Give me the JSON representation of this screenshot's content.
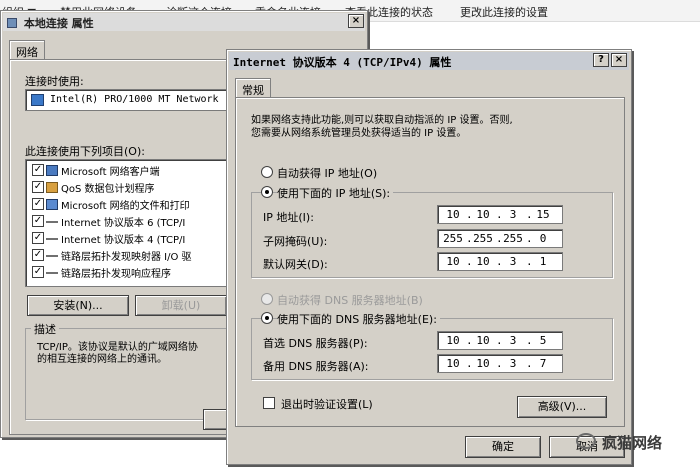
{
  "command_bar": {
    "items": [
      "组织 ▼",
      "禁用此网络设备",
      "诊断这个连接",
      "重命名此连接",
      "查看此连接的状态",
      "更改此连接的设置"
    ]
  },
  "local_conn": {
    "title": "本地连接 属性",
    "close": "×",
    "tab": "网络",
    "connect_using_label": "连接时使用:",
    "adapter": "Intel(R) PRO/1000 MT Network",
    "items_label": "此连接使用下列项目(O):",
    "items": [
      {
        "label": "Microsoft 网络客户端",
        "checked": true,
        "icon": "network-client-icon"
      },
      {
        "label": "QoS 数据包计划程序",
        "checked": true,
        "icon": "qos-icon"
      },
      {
        "label": "Microsoft 网络的文件和打印",
        "checked": true,
        "icon": "file-print-sharing-icon"
      },
      {
        "label": "Internet 协议版本 6 (TCP/I",
        "checked": true,
        "icon": "protocol-icon"
      },
      {
        "label": "Internet 协议版本 4 (TCP/I",
        "checked": true,
        "icon": "protocol-icon"
      },
      {
        "label": "链路层拓扑发现映射器 I/O 驱",
        "checked": true,
        "icon": "protocol-icon"
      },
      {
        "label": "链路层拓扑发现响应程序",
        "checked": true,
        "icon": "protocol-icon"
      }
    ],
    "install_button": "安装(N)...",
    "uninstall_button": "卸载(U)",
    "description_label": "描述",
    "description_line1": "TCP/IP。该协议是默认的广域网络协",
    "description_line2": "的相互连接的网络上的通讯。"
  },
  "ipv4": {
    "title": "Internet 协议版本 4 (TCP/IPv4) 属性",
    "help_button": "?",
    "close_button": "×",
    "tab": "常规",
    "intro_line1": "如果网络支持此功能,则可以获取自动指派的 IP 设置。否则,",
    "intro_line2": "您需要从网络系统管理员处获得适当的 IP 设置。",
    "auto_ip": "自动获得 IP 地址(O)",
    "manual_ip": "使用下面的 IP 地址(S):",
    "ip_label": "IP 地址(I):",
    "ip": [
      "10",
      "10",
      "3",
      "15"
    ],
    "mask_label": "子网掩码(U):",
    "mask": [
      "255",
      "255",
      "255",
      "0"
    ],
    "gateway_label": "默认网关(D):",
    "gateway": [
      "10",
      "10",
      "3",
      "1"
    ],
    "auto_dns": "自动获得 DNS 服务器地址(B)",
    "manual_dns": "使用下面的 DNS 服务器地址(E):",
    "dns1_label": "首选 DNS 服务器(P):",
    "dns1": [
      "10",
      "10",
      "3",
      "5"
    ],
    "dns2_label": "备用 DNS 服务器(A):",
    "dns2": [
      "10",
      "10",
      "3",
      "7"
    ],
    "validate_label": "退出时验证设置(L)",
    "advanced_button": "高级(V)...",
    "ok_button": "确定",
    "cancel_button": "取消"
  },
  "watermark": "疯猫网络",
  "colors": {
    "dialog_face": "#d4d0c8",
    "title_active": "#c8ccd3",
    "field_bg": "#ffffff"
  }
}
